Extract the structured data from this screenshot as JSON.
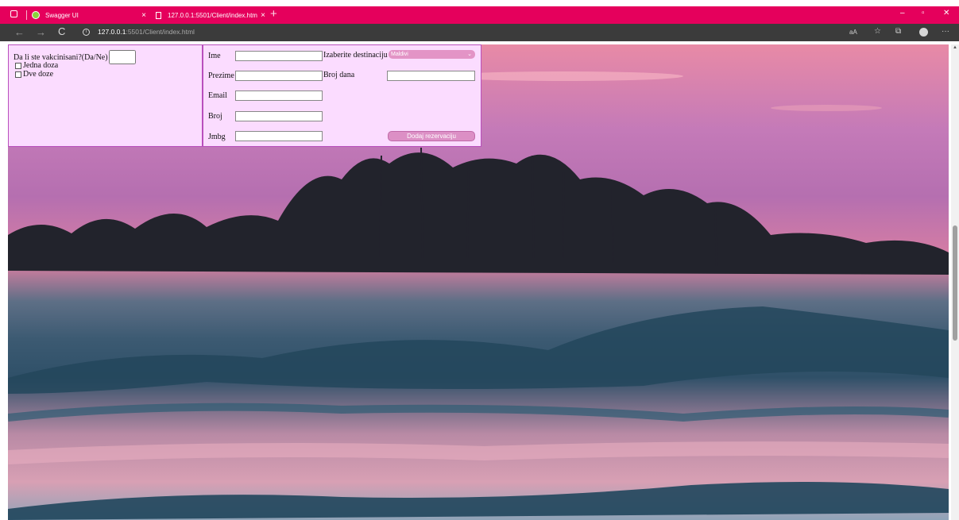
{
  "browser": {
    "tabs": [
      {
        "title": "Swagger UI",
        "close": "×"
      },
      {
        "title": "127.0.0.1:5501/Client/index.html",
        "close": "×"
      }
    ],
    "new_tab": "+",
    "window_controls": {
      "minimize": "–",
      "maximize": "▫",
      "close": "✕"
    },
    "nav": {
      "back": "←",
      "forward": "→",
      "reload": "C"
    },
    "url_host": "127.0.0.1",
    "url_path": ":5501/Client/index.html",
    "toolbar": {
      "read_aloud": "aA",
      "favorites": "☆",
      "collections": "⧉",
      "menu": "···"
    }
  },
  "vaccination": {
    "question": "Da li ste vakcinisani?(Da/Ne)",
    "answer_value": "",
    "options": [
      "Jedna doza",
      "Dve doze"
    ]
  },
  "form": {
    "labels": {
      "ime": "Ime",
      "prezime": "Prezime",
      "email": "Email",
      "broj": "Broj",
      "jmbg": "Jmbg",
      "destinacija": "Izaberite destinaciju",
      "broj_dana": "Broj dana"
    },
    "destination_selected": "Maldivi",
    "submit_label": "Dodaj rezervaciju"
  },
  "colors": {
    "tab_bar": "#e5005c",
    "address_bar": "#3b3b3b",
    "panel_bg": "#fbdcff",
    "panel_border": "#b94fbd",
    "button": "#dc8fc5"
  },
  "icons": [
    "window-icon",
    "swagger-favicon",
    "page-icon",
    "info-icon",
    "chevron-down-icon",
    "avatar"
  ]
}
